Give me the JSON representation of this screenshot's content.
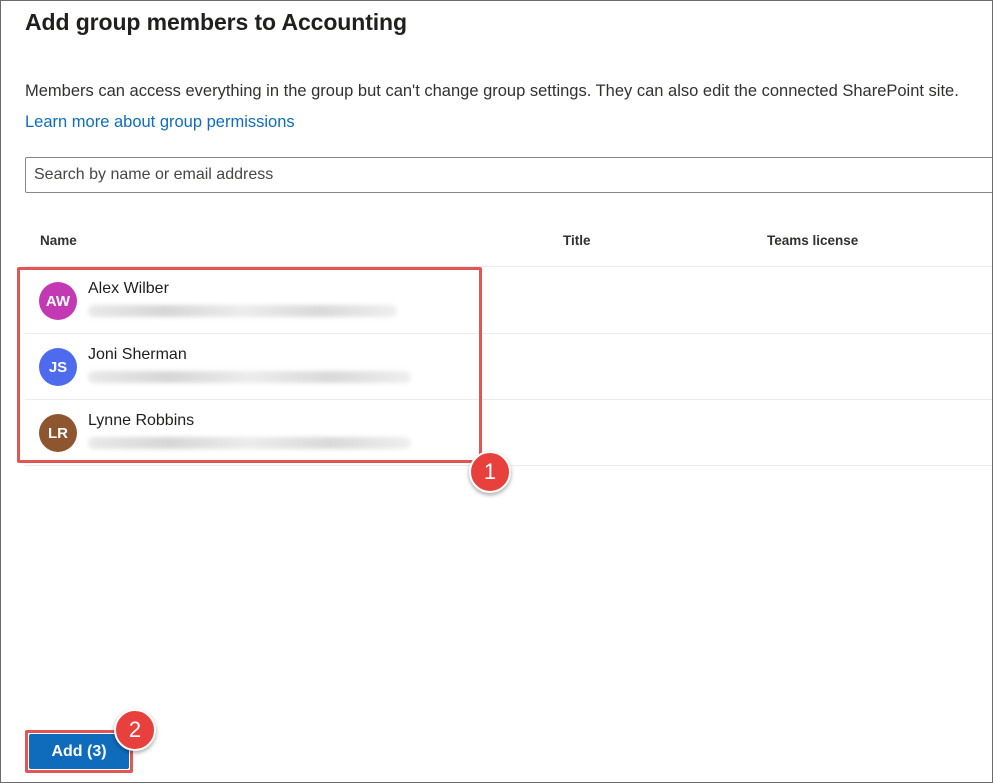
{
  "panel": {
    "title": "Add group members to Accounting",
    "description": "Members can access everything in the group but can't change group settings. They can also edit the connected SharePoint site.",
    "learn_more": "Learn more about group permissions"
  },
  "search": {
    "placeholder": "Search by name or email address"
  },
  "table": {
    "columns": [
      "Name",
      "Title",
      "Teams license"
    ],
    "members": [
      {
        "initials": "AW",
        "name": "Alex Wilber",
        "avatar_color": "#c239b3"
      },
      {
        "initials": "JS",
        "name": "Joni Sherman",
        "avatar_color": "#4f6bed"
      },
      {
        "initials": "LR",
        "name": "Lynne Robbins",
        "avatar_color": "#8e562e"
      }
    ]
  },
  "callouts": [
    "1",
    "2"
  ],
  "footer": {
    "add_label": "Add (3)"
  },
  "colors": {
    "accent": "#0f6cbd",
    "callout": "#e8413d"
  }
}
